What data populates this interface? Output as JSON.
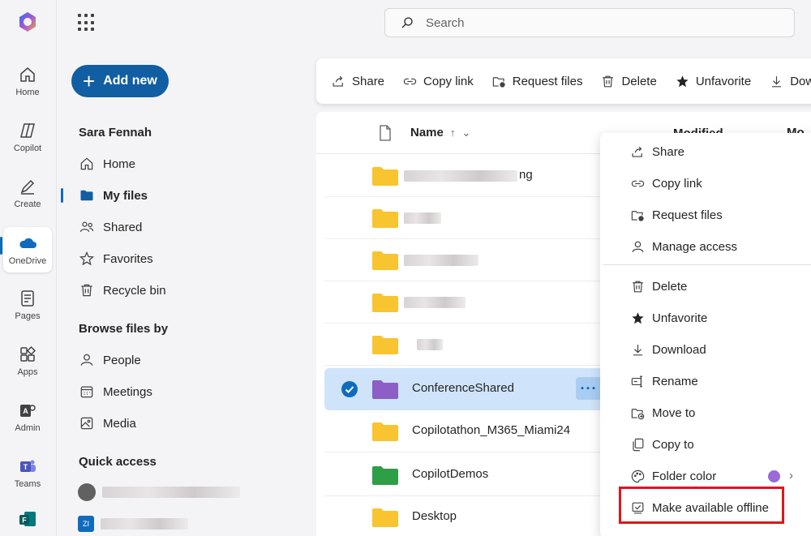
{
  "app": {
    "search_placeholder": "Search"
  },
  "rail": [
    {
      "label": "Home",
      "icon": "home-icon"
    },
    {
      "label": "Copilot",
      "icon": "copilot-icon"
    },
    {
      "label": "Create",
      "icon": "create-icon"
    },
    {
      "label": "OneDrive",
      "icon": "onedrive-icon",
      "active": true
    },
    {
      "label": "Pages",
      "icon": "pages-icon"
    },
    {
      "label": "Apps",
      "icon": "apps-icon"
    },
    {
      "label": "Admin",
      "icon": "admin-icon"
    },
    {
      "label": "Teams",
      "icon": "teams-icon"
    }
  ],
  "add_new_label": "Add new",
  "sidebar": {
    "user_name": "Sara Fennah",
    "items": [
      {
        "label": "Home",
        "icon": "home-icon"
      },
      {
        "label": "My files",
        "icon": "folder-icon",
        "active": true
      },
      {
        "label": "Shared",
        "icon": "people-icon"
      },
      {
        "label": "Favorites",
        "icon": "star-icon"
      },
      {
        "label": "Recycle bin",
        "icon": "trash-icon"
      }
    ],
    "browse_heading": "Browse files by",
    "browse_items": [
      {
        "label": "People",
        "icon": "person-icon"
      },
      {
        "label": "Meetings",
        "icon": "calendar-icon"
      },
      {
        "label": "Media",
        "icon": "image-icon"
      }
    ],
    "quick_access_heading": "Quick access",
    "quick_access_badge": "ZI"
  },
  "toolbar": {
    "buttons": [
      {
        "label": "Share",
        "icon": "share-icon"
      },
      {
        "label": "Copy link",
        "icon": "link-icon"
      },
      {
        "label": "Request files",
        "icon": "request-files-icon"
      },
      {
        "label": "Delete",
        "icon": "trash-icon"
      },
      {
        "label": "Unfavorite",
        "icon": "star-filled-icon"
      },
      {
        "label": "Dow",
        "icon": "download-icon"
      }
    ]
  },
  "file_list": {
    "col_name": "Name",
    "col_sort": "↑",
    "col_name_menu": "⌄",
    "col_modified": "Modified ⌄",
    "col_modified_by": "Mo",
    "rows": [
      {
        "name_suffix": "ng",
        "folder_color": "#f8c42f"
      },
      {
        "name_suffix": "",
        "folder_color": "#f8c42f"
      },
      {
        "name_suffix": "",
        "folder_color": "#f8c42f"
      },
      {
        "name_suffix": "",
        "folder_color": "#f8c42f"
      },
      {
        "name_suffix": "",
        "folder_color": "#f8c42f"
      },
      {
        "name": "ConferenceShared",
        "folder_color": "#8c5ec6",
        "selected": true,
        "more_label": "···"
      },
      {
        "name": "Copilotathon_M365_Miami24",
        "folder_color": "#f8c42f"
      },
      {
        "name": "CopilotDemos",
        "folder_color": "#2e9e47"
      },
      {
        "name": "Desktop",
        "folder_color": "#f8c42f"
      }
    ]
  },
  "context_menu": {
    "items": [
      {
        "label": "Share",
        "icon": "share-icon"
      },
      {
        "label": "Copy link",
        "icon": "link-icon"
      },
      {
        "label": "Request files",
        "icon": "request-files-icon"
      },
      {
        "label": "Manage access",
        "icon": "person-icon"
      },
      {
        "label": "Delete",
        "icon": "trash-icon"
      },
      {
        "label": "Unfavorite",
        "icon": "star-filled-icon"
      },
      {
        "label": "Download",
        "icon": "download-icon"
      },
      {
        "label": "Rename",
        "icon": "rename-icon"
      },
      {
        "label": "Move to",
        "icon": "move-icon"
      },
      {
        "label": "Copy to",
        "icon": "copy-icon"
      },
      {
        "label": "Folder color",
        "icon": "palette-icon",
        "swatch": "#9a6ad6",
        "chevron": "›"
      },
      {
        "label": "Make available offline",
        "icon": "offline-icon"
      }
    ],
    "highlight_color": "#e3141a"
  }
}
